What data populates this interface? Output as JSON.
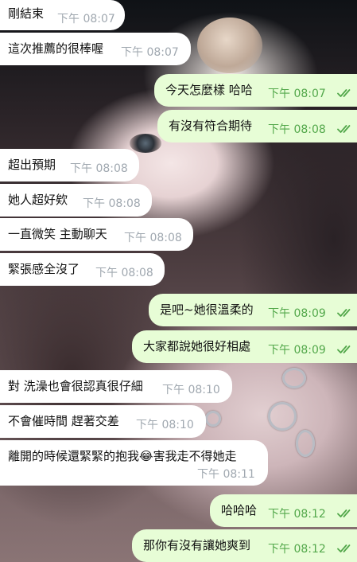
{
  "chat": {
    "background": {
      "description_icon": "photo-wallpaper",
      "colors": {
        "incoming_bubble": "#ffffff",
        "outgoing_bubble": "#e7fdd6",
        "incoming_time": "#a0a8b0",
        "outgoing_time": "#53a84b"
      }
    },
    "messages": [
      {
        "dir": "in",
        "text": "剛結束",
        "time": "下午 08:07"
      },
      {
        "dir": "in",
        "text": "這次推薦的很棒喔",
        "time": "下午 08:07"
      },
      {
        "dir": "out",
        "text": "今天怎麼樣 哈哈",
        "time": "下午 08:07",
        "status": "read"
      },
      {
        "dir": "out",
        "text": "有沒有符合期待",
        "time": "下午 08:08",
        "status": "read"
      },
      {
        "dir": "in",
        "text": "超出預期",
        "time": "下午 08:08"
      },
      {
        "dir": "in",
        "text": "她人超好欸",
        "time": "下午 08:08"
      },
      {
        "dir": "in",
        "text": "一直微笑 主動聊天",
        "time": "下午 08:08"
      },
      {
        "dir": "in",
        "text": "緊張感全沒了",
        "time": "下午 08:08"
      },
      {
        "dir": "out",
        "text": "是吧~她很溫柔的",
        "time": "下午 08:09",
        "status": "read"
      },
      {
        "dir": "out",
        "text": "大家都說她很好相處",
        "time": "下午 08:09",
        "status": "read"
      },
      {
        "dir": "in",
        "text": "對 洗澡也會很認真很仔細",
        "time": "下午 08:10"
      },
      {
        "dir": "in",
        "text": "不會催時間 趕著交差",
        "time": "下午 08:10"
      },
      {
        "dir": "in",
        "text": "離開的時候還緊緊的抱我😂害我走不得她走",
        "time": "下午 08:11"
      },
      {
        "dir": "out",
        "text": "哈哈哈",
        "time": "下午 08:12",
        "status": "read"
      },
      {
        "dir": "out",
        "text": "那你有沒有讓她爽到",
        "time": "下午 08:12",
        "status": "read"
      }
    ]
  }
}
